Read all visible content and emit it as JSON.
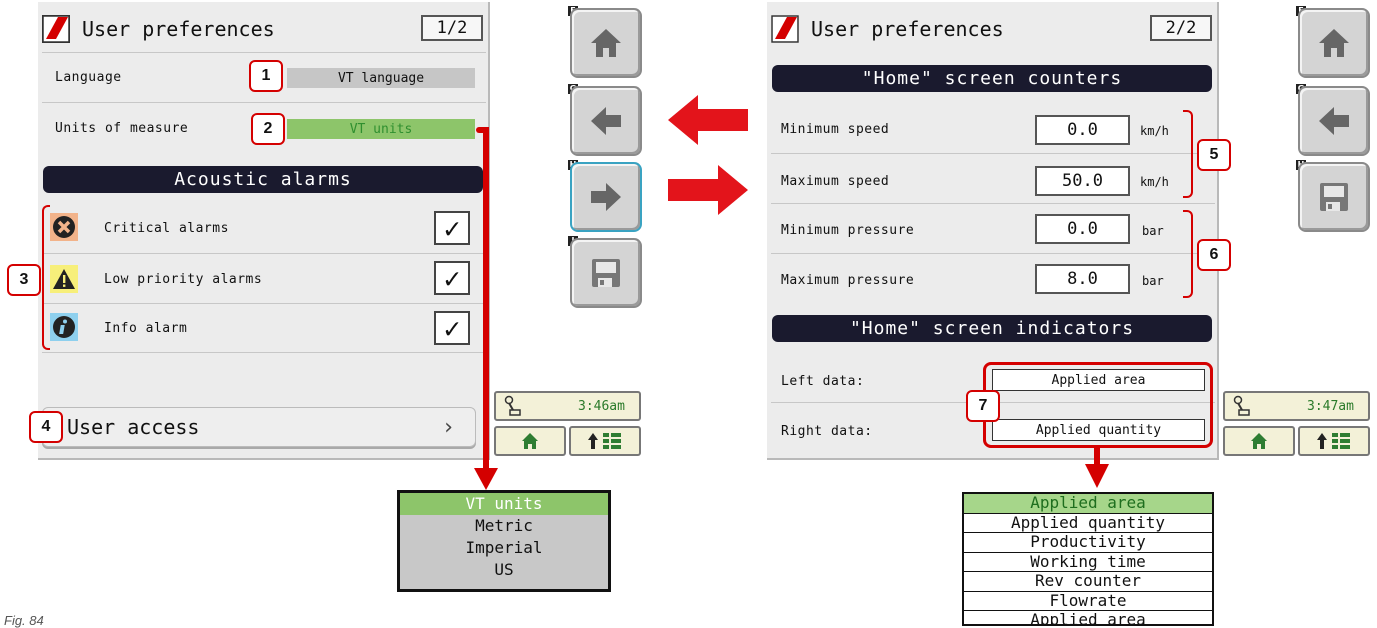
{
  "screen1": {
    "title": "User preferences",
    "page": "1/2",
    "language_label": "Language",
    "language_value": "VT language",
    "units_label": "Units of measure",
    "units_value": "VT units",
    "section_title": "Acoustic alarms",
    "alarms": [
      {
        "label": "Critical alarms",
        "icon": "critical-x-icon",
        "checked": "✓"
      },
      {
        "label": "Low priority alarms",
        "icon": "warning-triangle-icon",
        "checked": "✓"
      },
      {
        "label": "Info alarm",
        "icon": "info-icon",
        "checked": "✓"
      }
    ],
    "user_access": "User access",
    "chevron": "›",
    "time": "3:46am",
    "units_options": [
      "VT units",
      "Metric",
      "Imperial",
      "US"
    ]
  },
  "screen2": {
    "title": "User preferences",
    "page": "2/2",
    "counters_title": "\"Home\" screen counters",
    "min_speed_label": "Minimum speed",
    "min_speed_value": "0.0",
    "max_speed_label": "Maximum speed",
    "max_speed_value": "50.0",
    "speed_unit": "km/h",
    "min_pressure_label": "Minimum pressure",
    "min_pressure_value": "0.0",
    "max_pressure_label": "Maximum pressure",
    "max_pressure_value": "8.0",
    "pressure_unit": "bar",
    "indicators_title": "\"Home\" screen indicators",
    "left_label": "Left data:",
    "left_value": "Applied area",
    "right_label": "Right data:",
    "right_value": "Applied quantity",
    "time": "3:47am",
    "data_options": [
      "Applied area",
      "Applied quantity",
      "Productivity",
      "Working time",
      "Rev counter",
      "Flowrate",
      "Applied area"
    ]
  },
  "side_keys": [
    "F",
    "G",
    "H",
    "I"
  ],
  "badges": [
    "1",
    "2",
    "3",
    "4",
    "5",
    "6",
    "7"
  ],
  "caption": "Fig. 84",
  "colors": {
    "accent_red": "#d40000",
    "green_field": "#8dc56a",
    "section_bg": "#1a1a2e"
  }
}
